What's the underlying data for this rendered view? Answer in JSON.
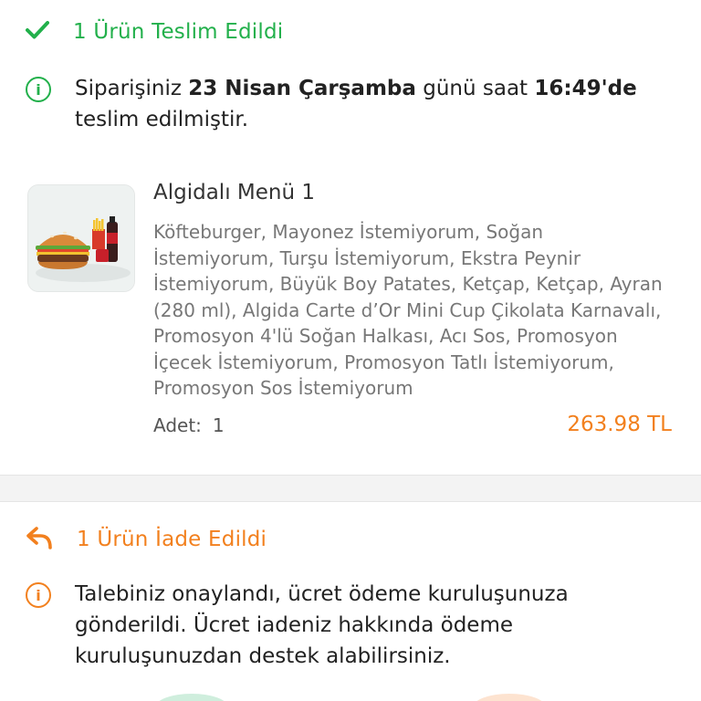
{
  "delivered": {
    "title": "1 Ürün Teslim Edildi",
    "icon": "check-icon",
    "color": "#22b04b"
  },
  "delivery_info": {
    "icon": "info-icon",
    "prefix": "Siparişiniz ",
    "date": "23 Nisan Çarşamba",
    "middle": " günü saat ",
    "time": "16:49'de",
    "suffix": "teslim edilmiştir."
  },
  "product": {
    "name": "Algidalı Menü 1",
    "description": "Köfteburger, Mayonez İstemiyorum, Soğan İstemiyorum, Turşu İstemiyorum, Ekstra Peynir İstemiyorum, Büyük Boy Patates, Ketçap, Ketçap, Ayran (280 ml), Algida Carte d’Or Mini Cup Çikolata Karnavalı, Promosyon 4'lü Soğan Halkası, Acı Sos, Promosyon İçecek İstemiyorum, Promosyon Tatlı İstemiyorum, Promosyon Sos İstemiyorum",
    "qty_label": "Adet:",
    "qty_value": "1",
    "price": "263.98 TL",
    "price_color": "#f2801e"
  },
  "returned": {
    "title": "1 Ürün İade Edildi",
    "icon": "return-arrow-icon",
    "color": "#f2801e",
    "info_icon": "info-icon",
    "info_text": "Talebiniz onaylandı, ücret ödeme kuruluşunuza gönderildi. Ücret iadeniz hakkında ödeme kuruluşunuzdan destek alabilirsiniz."
  }
}
